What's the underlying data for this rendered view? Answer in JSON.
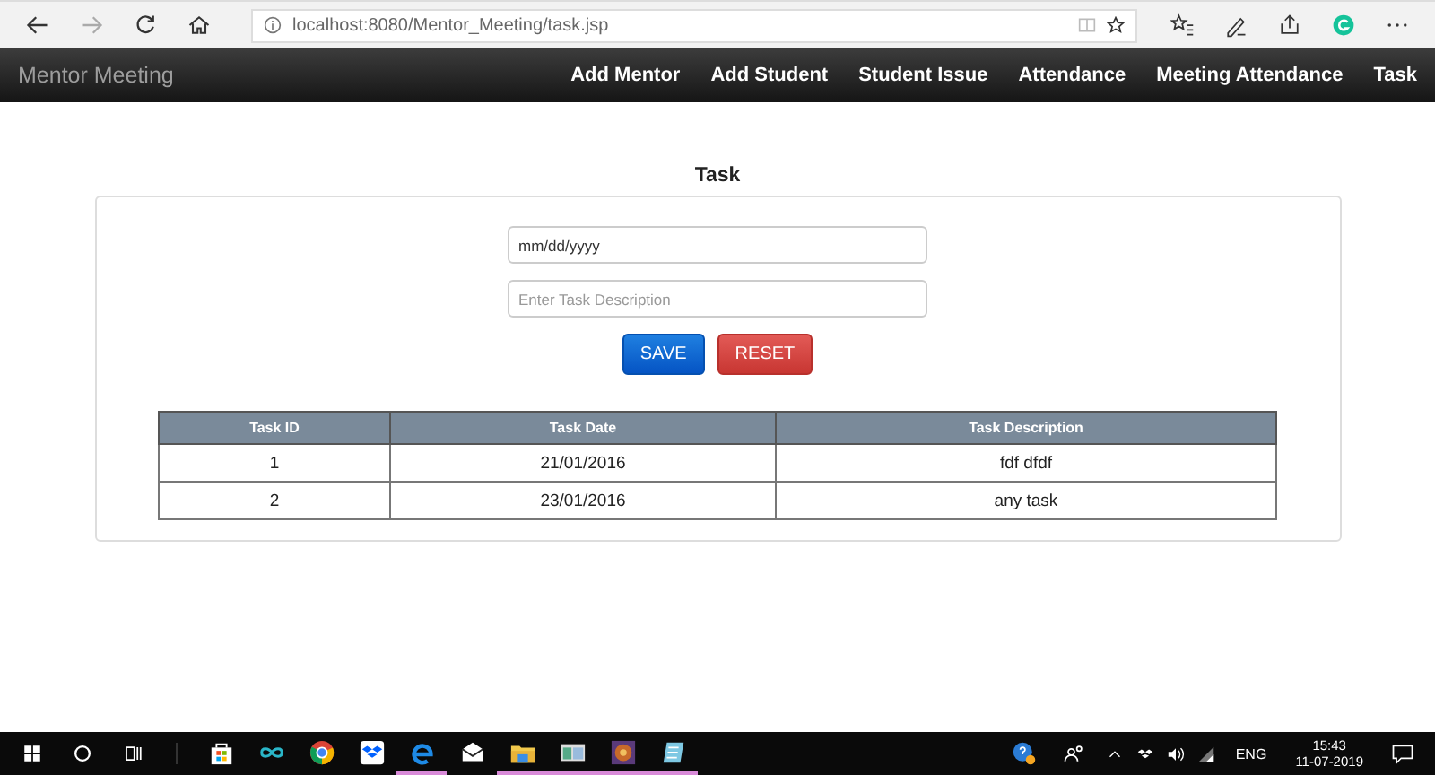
{
  "browser": {
    "url": "localhost:8080/Mentor_Meeting/task.jsp"
  },
  "navbar": {
    "brand": "Mentor Meeting",
    "links": [
      "Add Mentor",
      "Add Student",
      "Student Issue",
      "Attendance",
      "Meeting Attendance",
      "Task"
    ]
  },
  "page": {
    "title": "Task",
    "date_field": {
      "value": "mm/dd/yyyy"
    },
    "description_field": {
      "placeholder": "Enter Task Description"
    },
    "buttons": [
      {
        "label": "SAVE",
        "kind": "primary"
      },
      {
        "label": "RESET",
        "kind": "danger"
      }
    ]
  },
  "table": {
    "columns": [
      "Task ID",
      "Task Date",
      "Task Description"
    ],
    "rows": [
      [
        "1",
        "21/01/2016",
        "fdf dfdf"
      ],
      [
        "2",
        "23/01/2016",
        "any task"
      ]
    ]
  },
  "taskbar": {
    "apps": [
      {
        "kind": "store",
        "running": false
      },
      {
        "kind": "infinity",
        "running": false
      },
      {
        "kind": "chrome",
        "running": false
      },
      {
        "kind": "dropbox",
        "running": false
      },
      {
        "kind": "edge",
        "running": true
      },
      {
        "kind": "mail",
        "running": false
      },
      {
        "kind": "folder",
        "running": true
      },
      {
        "kind": "window",
        "running": true
      },
      {
        "kind": "game",
        "running": true
      },
      {
        "kind": "notes",
        "running": true
      }
    ],
    "language": "ENG",
    "time": "15:43",
    "date": "11-07-2019"
  }
}
